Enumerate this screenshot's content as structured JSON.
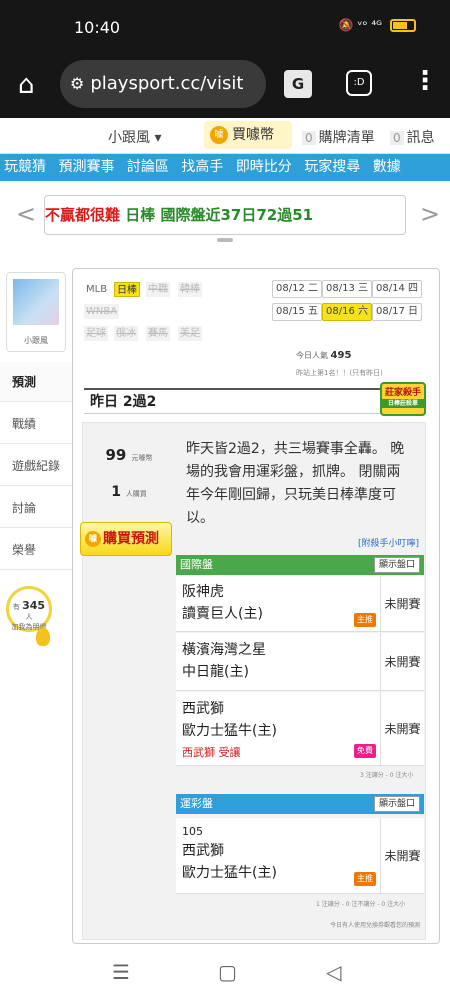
{
  "status": {
    "time": "10:40",
    "icons": "🔕 ᵛᵒ ⁴ᴳ"
  },
  "browser": {
    "url": "playsport.cc/visit",
    "home_icon": "⌂",
    "menu_icon": "⋮",
    "translate_label": "G",
    "tab_label": ":D"
  },
  "topnav": {
    "user": "小跟風 ▾",
    "coin_label": "買噱幣",
    "coin_symbol": "噱",
    "cart_count": "0",
    "cart": "購牌清單",
    "msg_count": "0",
    "msg": "訊息"
  },
  "bluenav": [
    "玩競猜",
    "預測賽事",
    "討論區",
    "找高手",
    "即時比分",
    "玩家搜尋",
    "數據"
  ],
  "ticker": {
    "prefix": "不贏都很難",
    "team": "日棒",
    "text": "國際盤近37日72過51"
  },
  "profile": {
    "name": "小跟風"
  },
  "sidebar": [
    "預測",
    "戰績",
    "遊戲紀錄",
    "討論",
    "榮譽"
  ],
  "fans": {
    "prefix": "有",
    "count": "345",
    "suffix": "人",
    "sub": "加我為明燈"
  },
  "leagues": [
    {
      "label": "MLB",
      "state": "normal"
    },
    {
      "label": "日棒",
      "state": "selected"
    },
    {
      "label": "中職",
      "state": "disabled"
    },
    {
      "label": "韓棒",
      "state": "disabled"
    },
    {
      "label": "WNBA",
      "state": "disabled"
    },
    {
      "label": "足球",
      "state": "disabled"
    },
    {
      "label": "俄冰",
      "state": "disabled"
    },
    {
      "label": "賽馬",
      "state": "disabled"
    },
    {
      "label": "美足",
      "state": "disabled"
    }
  ],
  "dates": [
    {
      "date": "08/12",
      "day": "二",
      "selected": false
    },
    {
      "date": "08/13",
      "day": "三",
      "selected": false
    },
    {
      "date": "08/14",
      "day": "四",
      "selected": false
    },
    {
      "date": "08/15",
      "day": "五",
      "selected": false
    },
    {
      "date": "08/16",
      "day": "六",
      "selected": true
    },
    {
      "date": "08/17",
      "day": "日",
      "selected": false
    }
  ],
  "popularity": {
    "label": "今日人氣",
    "value": "495",
    "rank": "昨站上第1名！！(只有昨日)"
  },
  "yesterday": "昨日 2過2",
  "hot_badge": {
    "title": "莊家殺手",
    "sub": "日棒莊殺單"
  },
  "stats": {
    "wins": "99",
    "wins_unit": "元噱幣",
    "buyers": "1",
    "buyers_unit": "人購買"
  },
  "buy_label": "購買預測",
  "post": "昨天皆2過2，共三場賽事全轟。 晚場的我會用運彩盤，抓牌。 閉關兩年今年剛回歸，只玩美日棒準度可以。",
  "addon": "[附殺手小叮嚀]",
  "intl": {
    "title": "國際盤",
    "show_btn": "顯示盤口",
    "games": [
      {
        "away": "阪神虎",
        "home": "讀賣巨人(主)",
        "tag": "主推",
        "tag_type": "o",
        "status": "未開賽",
        "note": ""
      },
      {
        "away": "橫濱海灣之星",
        "home": "中日龍(主)",
        "tag": "",
        "tag_type": "",
        "status": "未開賽",
        "note": ""
      },
      {
        "away": "西武獅",
        "home": "歐力士猛牛(主)",
        "tag": "免費",
        "tag_type": "p",
        "status": "未開賽",
        "note": "西武獅 受讓"
      }
    ],
    "footer": "3 注讓分 - 0 注大小"
  },
  "lotto": {
    "title": "運彩盤",
    "show_btn": "顯示盤口",
    "games": [
      {
        "num": "105",
        "away": "西武獅",
        "home": "歐力士猛牛(主)",
        "tag": "主推",
        "status": "未開賽"
      }
    ],
    "footer": "1 注讓分 - 0 注不讓分 - 0 注大小",
    "note": "今日有人使用兌換券觀看您的預測"
  },
  "navbar": {
    "menu": "☰",
    "home": "▢",
    "back": "◁"
  },
  "colors": {
    "blue_nav": "#2e9fd8",
    "green_header": "#4aa84a",
    "highlight_yellow": "#f5e21a",
    "red": "#d81c1c"
  }
}
